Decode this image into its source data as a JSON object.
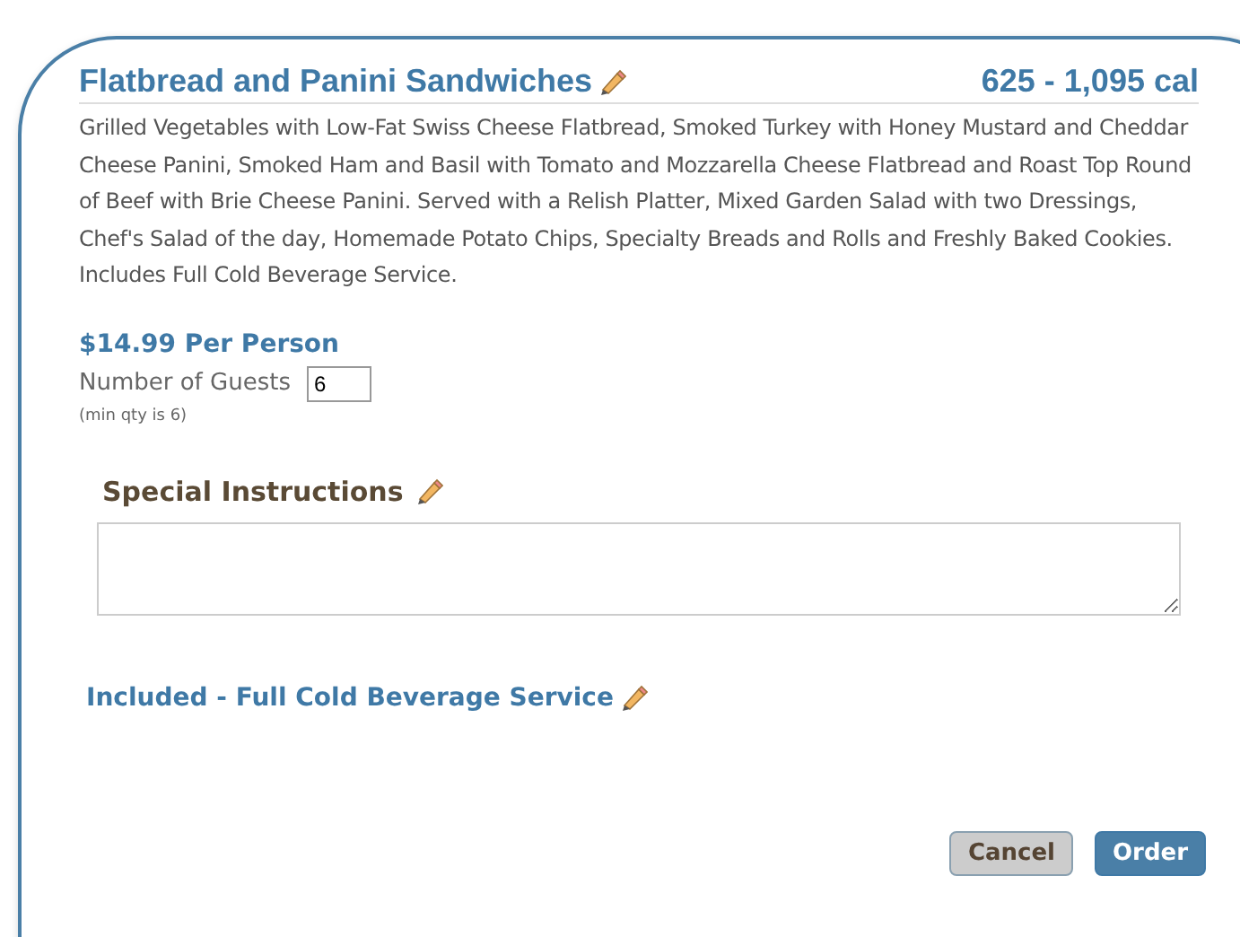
{
  "item": {
    "title": "Flatbread and Panini Sandwiches",
    "calories": "625 - 1,095 cal",
    "description": "Grilled Vegetables with Low-Fat Swiss Cheese Flatbread, Smoked Turkey with Honey Mustard and Cheddar Cheese Panini, Smoked Ham and Basil with Tomato and Mozzarella Cheese Flatbread and Roast Top Round of Beef with Brie Cheese Panini. Served with a Relish Platter, Mixed Garden Salad with two Dressings, Chef's Salad of the day, Homemade Potato Chips, Specialty Breads and Rolls and Freshly Baked Cookies. Includes Full Cold Beverage Service."
  },
  "price": "$14.99 Per Person",
  "guests": {
    "label": "Number of Guests",
    "value": "6",
    "note": "(min qty is 6)"
  },
  "special_instructions": {
    "label": "Special Instructions"
  },
  "included": "Included - Full Cold Beverage Service",
  "buttons": [
    {
      "kind": "secondary",
      "label": "Cancel"
    },
    {
      "kind": "primary",
      "label": "Order"
    }
  ]
}
